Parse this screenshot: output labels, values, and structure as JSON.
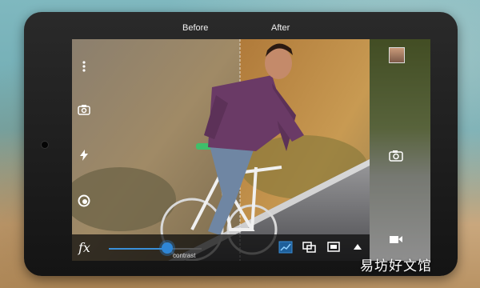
{
  "compare": {
    "before_label": "Before",
    "after_label": "After"
  },
  "edit": {
    "slider_label": "contrast",
    "fx_label": "fx",
    "slider_value_fraction": 0.72
  },
  "side_panel": {
    "avatar": "user-avatar",
    "camera": "camera-icon",
    "video": "video-camera-icon"
  },
  "left_tools": [
    "menu-dots-icon",
    "switch-camera-icon",
    "flash-icon",
    "shutter-mode-icon"
  ],
  "bottom_tools": [
    "curves-icon",
    "overlay-icon",
    "frame-icon",
    "expand-up-icon"
  ],
  "colors": {
    "accent": "#2f86d6",
    "bezel": "#1c1c1c"
  },
  "watermark": "易坊好文馆"
}
